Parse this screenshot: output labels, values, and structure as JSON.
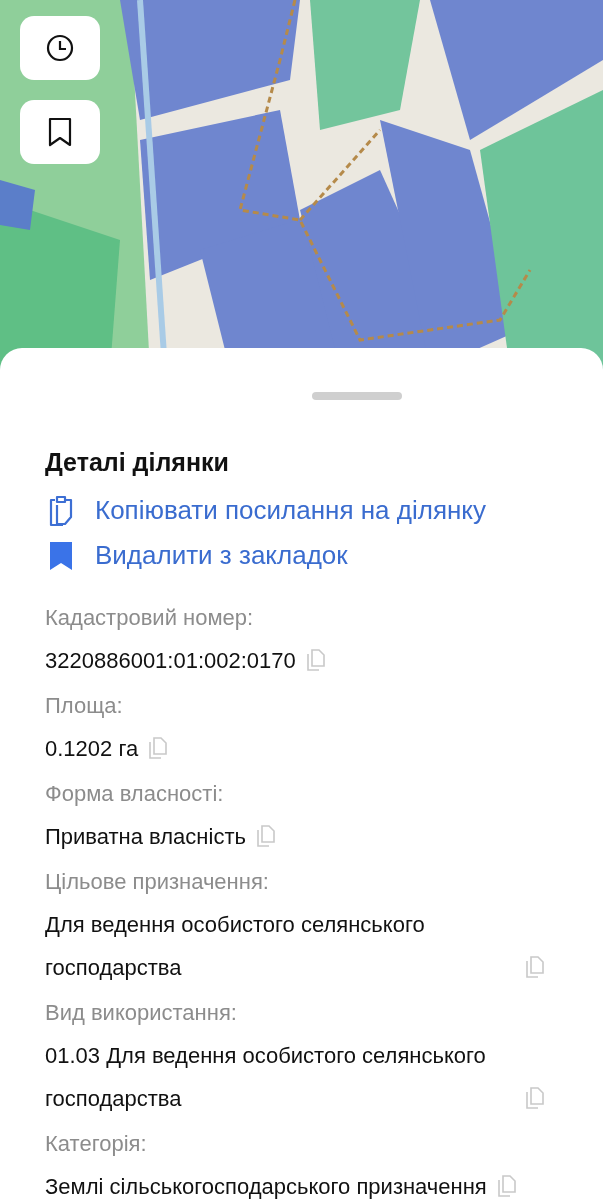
{
  "map_buttons": [
    {
      "kind": "clock"
    },
    {
      "kind": "bookmark"
    }
  ],
  "sheet": {
    "title": "Деталі ділянки",
    "actions": [
      {
        "kind": "copy",
        "label": "Копіювати посилання на ділянку"
      },
      {
        "kind": "bookmark",
        "label": "Видалити з закладок"
      }
    ],
    "fields": [
      {
        "label": "Кадастровий номер:",
        "value": "3220886001:01:002:0170"
      },
      {
        "label": "Площа:",
        "value": "0.1202 га"
      },
      {
        "label": "Форма власності:",
        "value": "Приватна власність"
      },
      {
        "label": "Цільове призначення:",
        "value": "Для ведення особистого селянського господарства"
      },
      {
        "label": "Вид використання:",
        "value": "01.03 Для ведення особистого селянського господарства"
      },
      {
        "label": "Категорія:",
        "value": "Землі сільськогосподарського призначення"
      }
    ]
  }
}
